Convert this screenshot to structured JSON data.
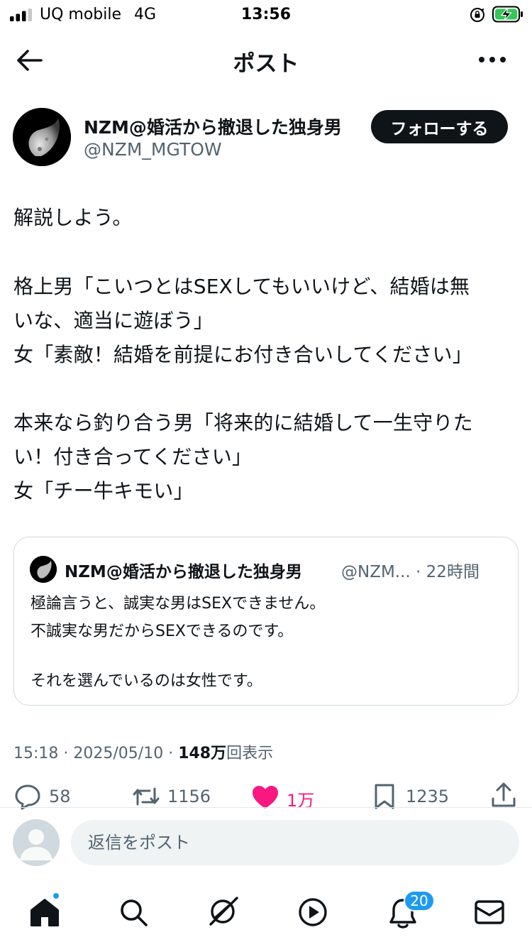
{
  "status_bar": {
    "carrier": "UQ mobile",
    "network": "4G",
    "time": "13:56",
    "signal_icon": "cellular-signal-icon",
    "battery_icon": "battery-charging-icon"
  },
  "header": {
    "title": "ポスト",
    "back_icon": "arrow-left-icon",
    "more_icon": "more-dots-icon"
  },
  "author": {
    "name": "NZM@婚活から撤退した独身男",
    "handle": "@NZM_MGTOW",
    "follow_label": "フォローする"
  },
  "tweet": {
    "lines": [
      "解説しよう。",
      "格上男「こいつとはSEXしてもいいけど、結婚は無",
      "いな、適当に遊ぼう」",
      "女「素敵！結婚を前提にお付き合いしてください」",
      "本来なら釣り合う男「将来的に結婚して一生守りた",
      "い！付き合ってください」",
      "女「チー牛キモい」"
    ]
  },
  "quote": {
    "name": "NZM@婚活から撤退した独身男",
    "meta": "@NZM... · 22時間",
    "lines": [
      "極論言うと、誠実な男はSEXできません。",
      "不誠実な男だからSEXできるのです。",
      "それを選んでいるのは女性です。"
    ]
  },
  "meta": {
    "time": "15:18",
    "separator": " · ",
    "date": "2025/05/10",
    "views_value": "148万",
    "views_label": "回表示"
  },
  "actions": {
    "replies": "58",
    "reposts": "1156",
    "likes": "1万",
    "bookmarks": "1235",
    "like_color": "#f91880"
  },
  "reply_bar": {
    "placeholder": "返信をポスト"
  },
  "bottom_nav": {
    "notification_count": "20",
    "accent": "#1d9bf0"
  }
}
